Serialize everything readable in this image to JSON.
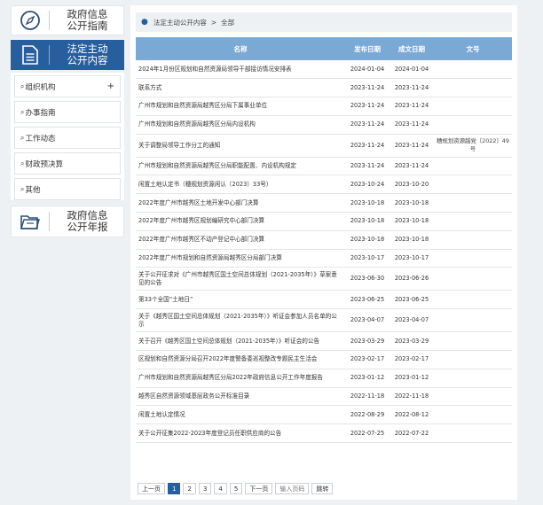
{
  "sidebar": {
    "guide": {
      "line1": "政府信息",
      "line2": "公开指南",
      "icon": "compass-icon"
    },
    "active": {
      "line1": "法定主动",
      "line2": "公开内容",
      "icon": "document-icon"
    },
    "items": [
      {
        "label": "组织机构",
        "expand": "+"
      },
      {
        "label": "办事指南"
      },
      {
        "label": "工作动态"
      },
      {
        "label": "财政预决算"
      },
      {
        "label": "其他"
      }
    ],
    "report": {
      "line1": "政府信息",
      "line2": "公开年报",
      "icon": "folder-icon"
    }
  },
  "breadcrumb": {
    "section": "法定主动公开内容",
    "separator": ">",
    "current": "全部"
  },
  "table": {
    "headers": {
      "name": "名称",
      "published": "发布日期",
      "effective": "成文日期",
      "number": "文号"
    },
    "rows": [
      {
        "name": "2024年1月份区规划和自然资源局领导干部接访情况安排表",
        "published": "2024-01-04",
        "effective": "2024-01-04",
        "number": ""
      },
      {
        "name": "联系方式",
        "published": "2023-11-24",
        "effective": "2023-11-24",
        "number": ""
      },
      {
        "name": "广州市规划和自然资源局越秀区分局下属事业单位",
        "published": "2023-11-24",
        "effective": "2023-11-24",
        "number": ""
      },
      {
        "name": "广州市规划和自然资源局越秀区分局内设机构",
        "published": "2023-11-24",
        "effective": "2023-11-24",
        "number": ""
      },
      {
        "name": "关于调整局领导工作分工的通知",
        "published": "2023-11-24",
        "effective": "2023-11-24",
        "number": "穗规划资源越党〔2022〕49号"
      },
      {
        "name": "广州市规划和自然资源局越秀区分局职能配置、内设机构规定",
        "published": "2023-11-24",
        "effective": "2023-11-24",
        "number": ""
      },
      {
        "name": "闲置土地认定书（穗规划资源闲认〔2023〕33号）",
        "published": "2023-10-24",
        "effective": "2023-10-20",
        "number": ""
      },
      {
        "name": "2022年度广州市越秀区土地开发中心部门决算",
        "published": "2023-10-18",
        "effective": "2023-10-18",
        "number": ""
      },
      {
        "name": "2022年度广州市越秀区规划编研究中心部门决算",
        "published": "2023-10-18",
        "effective": "2023-10-18",
        "number": ""
      },
      {
        "name": "2022年度广州市越秀区不动产登记中心部门决算",
        "published": "2023-10-18",
        "effective": "2023-10-18",
        "number": ""
      },
      {
        "name": "2022年度广州市规划和自然资源局越秀区分局部门决算",
        "published": "2023-10-17",
        "effective": "2023-10-17",
        "number": ""
      },
      {
        "name": "关于公开征求对《广州市越秀区国土空间总体规划（2021-2035年）》草案意见的公告",
        "published": "2023-06-30",
        "effective": "2023-06-26",
        "number": ""
      },
      {
        "name": "第33个全国“土地日”",
        "published": "2023-06-25",
        "effective": "2023-06-25",
        "number": ""
      },
      {
        "name": "关于《越秀区国土空间总体规划（2021-2035年）》听证会参加人员名单的公示",
        "published": "2023-04-07",
        "effective": "2023-04-07",
        "number": ""
      },
      {
        "name": "关于召开《越秀区国土空间总体规划（2021-2035年）》听证会的公告",
        "published": "2023-03-29",
        "effective": "2023-03-29",
        "number": ""
      },
      {
        "name": "区规划和自然资源分局召开2022年度警备委巡视整改专题民主生活会",
        "published": "2023-02-17",
        "effective": "2023-02-17",
        "number": ""
      },
      {
        "name": "广州市规划和自然资源局越秀区分局2022年政府信息公开工作年度报告",
        "published": "2023-01-12",
        "effective": "2023-01-12",
        "number": ""
      },
      {
        "name": "越秀区自然资源领域基层政务公开标准目录",
        "published": "2022-11-18",
        "effective": "2022-11-18",
        "number": ""
      },
      {
        "name": "闲置土地认定情况",
        "published": "2022-08-29",
        "effective": "2022-08-12",
        "number": ""
      },
      {
        "name": "关于公开征集2022-2023年度登记员任职供应商的公告",
        "published": "2022-07-25",
        "effective": "2022-07-22",
        "number": ""
      }
    ]
  },
  "pager": {
    "prev": "上一页",
    "pages": [
      "1",
      "2",
      "3",
      "4",
      "5"
    ],
    "current": "1",
    "next": "下一页",
    "input_placeholder": "输入页码",
    "jump": "跳转"
  }
}
